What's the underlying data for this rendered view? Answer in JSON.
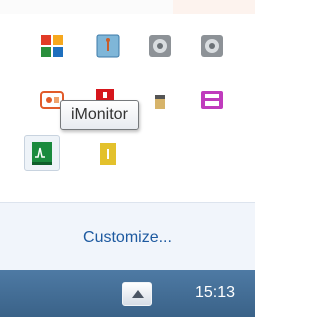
{
  "tray_flyout": {
    "tooltip": "iMonitor",
    "customize_link": "Customize...",
    "icons": [
      "avg-antivirus-icon",
      "network-icon",
      "gear-icon",
      "gear-icon",
      "camera-icon",
      "red-app-icon",
      "printer-icon",
      "imonitor-icon",
      "yellow-app-icon"
    ]
  },
  "taskbar": {
    "clock": "15:13",
    "show_hidden_icon": "triangle-up-icon"
  }
}
